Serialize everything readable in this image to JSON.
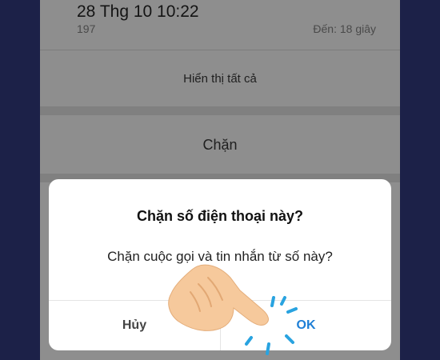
{
  "call_entry": {
    "date_time": "28 Thg 10 10:22",
    "number": "197",
    "duration": "Đến: 18 giây"
  },
  "actions": {
    "show_all": "Hiển thị tất cả",
    "block": "Chặn"
  },
  "dialog": {
    "title": "Chặn số điện thoại này?",
    "message": "Chặn cuộc gọi và tin nhắn từ số này?",
    "cancel_label": "Hủy",
    "ok_label": "OK"
  },
  "colors": {
    "background": "#1c2148",
    "ok_accent": "#1e7fd6",
    "tap_indicator": "#29a3e0",
    "hand": "#f6c99c"
  },
  "icons": {
    "pointer": "pointing-hand-icon",
    "tap": "tap-indicator-icon"
  }
}
